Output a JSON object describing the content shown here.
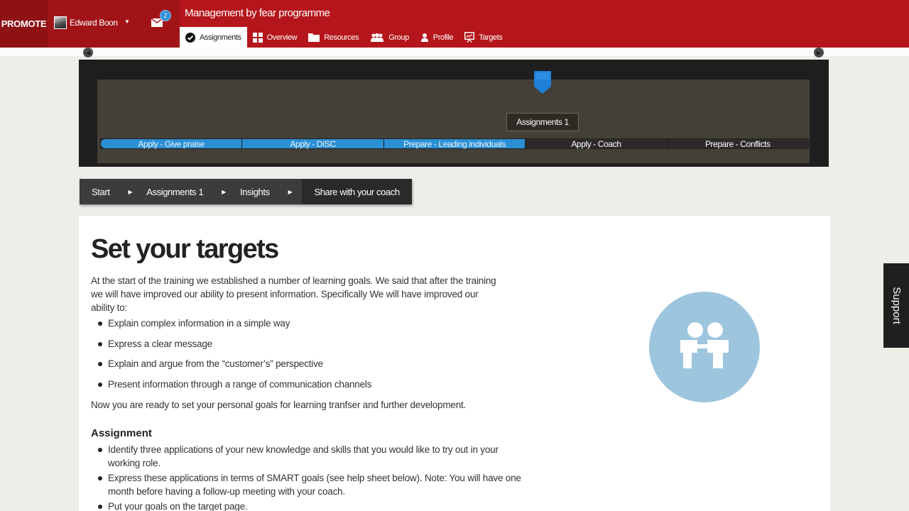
{
  "header": {
    "brand": "PROMOTE",
    "user_name": "Edward Boon",
    "mail_count": "2",
    "programme_title": "Management by fear programme",
    "nav": [
      {
        "label": "Assignments",
        "icon": "check-circle-icon",
        "active": true
      },
      {
        "label": "Overview",
        "icon": "grid-icon",
        "active": false
      },
      {
        "label": "Resources",
        "icon": "folder-icon",
        "active": false
      },
      {
        "label": "Group",
        "icon": "group-icon",
        "active": false
      },
      {
        "label": "Profile",
        "icon": "person-icon",
        "active": false
      },
      {
        "label": "Targets",
        "icon": "presentation-icon",
        "active": false
      }
    ]
  },
  "timeline": {
    "current_label": "Assignments 1",
    "segments": [
      {
        "label": "Apply - Give praise",
        "done": true
      },
      {
        "label": "Apply - DISC",
        "done": true
      },
      {
        "label": "Prepare - Leading individuals",
        "done": true
      },
      {
        "label": "Apply - Coach",
        "done": false
      },
      {
        "label": "Prepare - Conflicts",
        "done": false
      }
    ]
  },
  "breadcrumb": [
    {
      "label": "Start"
    },
    {
      "label": "Assignments 1"
    },
    {
      "label": "Insights"
    },
    {
      "label": "Share with your coach"
    }
  ],
  "content": {
    "title": "Set your targets",
    "intro": "At the start of the training we established a number of learning goals. We said that after the training we will have improved our ability to present information. Specifically We will have improved our ability to:",
    "goals": [
      "Explain complex information in a simple way",
      "Express a clear message",
      "Explain and argue from the “customer’s” perspective",
      "Present information through a range of communication channels"
    ],
    "outro": "Now you are ready to set your personal goals for learning tranfser and further development.",
    "assignment_heading": "Assignment",
    "tasks": [
      "Identify three applications of your new knowledge and skills that you would like to try out in your working role.",
      "Express these applications in terms of SMART goals (see help sheet below). Note: You will have one month before having a follow-up meeting with your coach.",
      "Put your goals on the target page."
    ]
  },
  "support_label": "Support",
  "colors": {
    "header_red": "#b5161b",
    "brand_dark_red": "#8e1114",
    "timeline_done_blue": "#2b8fd4",
    "illustration_blue": "#9dc5de"
  }
}
